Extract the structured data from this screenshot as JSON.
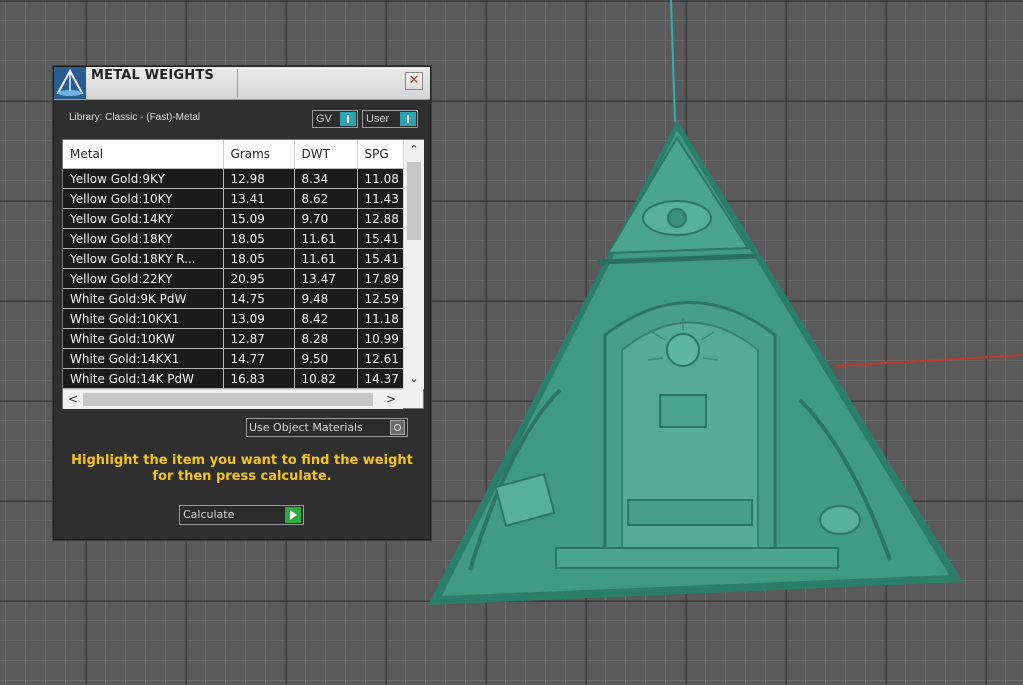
{
  "viewport": {
    "model_color": "#3f9a84",
    "axis_y_color": "#2bb3b3",
    "axis_x_color": "#c0392b"
  },
  "panel": {
    "title": "METAL WEIGHTS",
    "close_icon": "close-icon",
    "library_label": "Library: Classic - (Fast)-Metal",
    "toggles": {
      "gv": "GV",
      "user": "User"
    },
    "table": {
      "headers": [
        "Metal",
        "Grams",
        "DWT",
        "SPG"
      ],
      "rows": [
        [
          "Yellow Gold:9KY",
          "12.98",
          "8.34",
          "11.08"
        ],
        [
          "Yellow Gold:10KY",
          "13.41",
          "8.62",
          "11.43"
        ],
        [
          "Yellow Gold:14KY",
          "15.09",
          "9.70",
          "12.88"
        ],
        [
          "Yellow Gold:18KY",
          "18.05",
          "11.61",
          "15.41"
        ],
        [
          "Yellow Gold:18KY R...",
          "18.05",
          "11.61",
          "15.41"
        ],
        [
          "Yellow Gold:22KY",
          "20.95",
          "13.47",
          "17.89"
        ],
        [
          "White Gold:9K PdW",
          "14.75",
          "9.48",
          "12.59"
        ],
        [
          "White Gold:10KX1",
          "13.09",
          "8.42",
          "11.18"
        ],
        [
          "White Gold:10KW",
          "12.87",
          "8.28",
          "10.99"
        ],
        [
          "White Gold:14KX1",
          "14.77",
          "9.50",
          "12.61"
        ],
        [
          "White Gold:14K PdW",
          "16.83",
          "10.82",
          "14.37"
        ]
      ],
      "scroll_up": "⌃",
      "scroll_down": "⌄",
      "scroll_left": "<",
      "scroll_right": ">"
    },
    "use_object_materials": "Use Object Materials",
    "instructions_line1": "Highlight the item you want to find the weight",
    "instructions_line2": "for then press calculate.",
    "calculate_label": "Calculate",
    "accent_color": "#2fa3b5",
    "instruction_color": "#f5c518"
  }
}
